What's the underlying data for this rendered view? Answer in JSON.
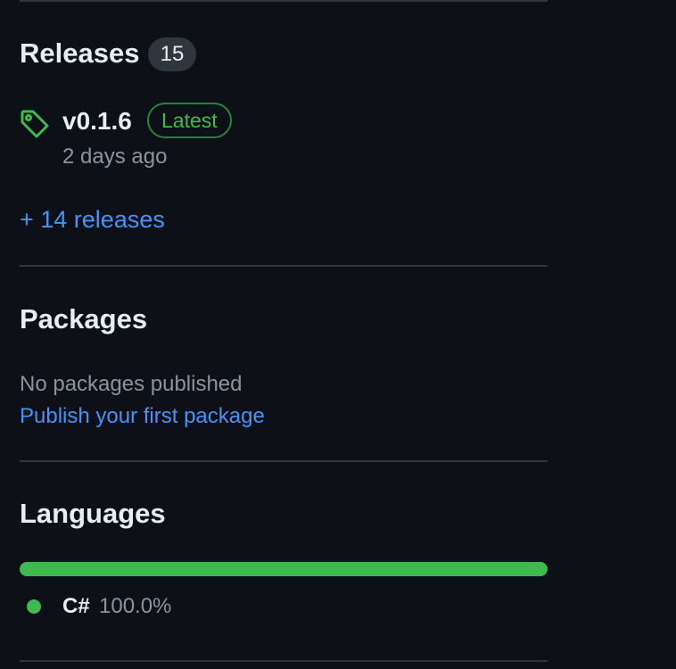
{
  "releases": {
    "title": "Releases",
    "count": "15",
    "latest": {
      "name": "v0.1.6",
      "badge": "Latest",
      "date": "2 days ago"
    },
    "more_link": "+ 14 releases"
  },
  "packages": {
    "title": "Packages",
    "empty_text": "No packages published",
    "publish_link": "Publish your first package"
  },
  "languages": {
    "title": "Languages",
    "items": [
      {
        "name": "C#",
        "percent": "100.0%",
        "fraction": 1.0,
        "color": "#3fb950"
      }
    ]
  },
  "colors": {
    "link": "#4493f8",
    "success": "#3fb950",
    "background": "#0d1117"
  },
  "icons": {
    "release_tag": "tag-icon"
  }
}
